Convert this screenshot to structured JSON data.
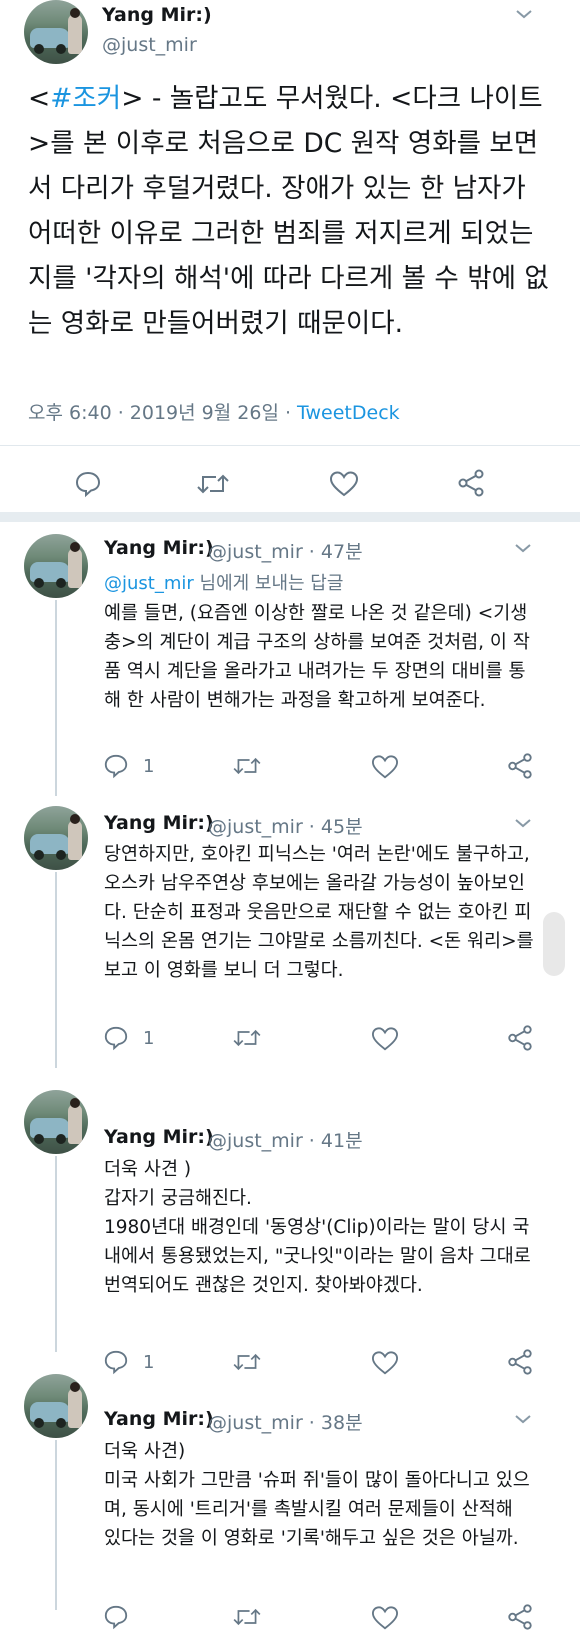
{
  "main_tweet": {
    "author_name": "Yang Mir:)",
    "author_handle": "@just_mir",
    "text_parts": {
      "before_tag": "<",
      "hashtag": "#조커",
      "after_tag": "> - 놀랍고도 무서웠다. <다크 나이트>를 본 이후로 처음으로 DC 원작 영화를 보면서 다리가 후덜거렸다. 장애가 있는 한 남자가 어떠한 이유로 그러한 범죄를 저지르게 되었는지를 '각자의 해석'에 따라 다르게 볼 수 밖에 없는 영화로 만들어버렸기 때문이다."
    },
    "timestamp": "오후 6:40 · 2019년 9월 26일 · ",
    "source": "TweetDeck"
  },
  "replies": [
    {
      "author_name": "Yang Mir:)",
      "handle_time": "@just_mir · 47분",
      "reply_to_link": "@just_mir",
      "reply_to_suffix": " 님에게 보내는 답글",
      "text": "예를 들면, (요즘엔 이상한 짤로 나온 것 같은데) <기생충>의 계단이 계급 구조의 상하를 보여준 것처럼, 이 작품 역시 계단을 올라가고 내려가는 두 장면의 대비를 통해 한 사람이 변해가는 과정을 확고하게 보여준다.",
      "reply_count": "1"
    },
    {
      "author_name": "Yang Mir:)",
      "handle_time": "@just_mir · 45분",
      "text": "당연하지만, 호아킨 피닉스는 '여러 논란'에도 불구하고, 오스카 남우주연상 후보에는 올라갈 가능성이 높아보인다. 단순히 표정과 웃음만으로 재단할 수 없는 호아킨 피닉스의 온몸 연기는 그야말로 소름끼친다. <돈 워리>를 보고 이 영화를 보니 더 그렇다.",
      "reply_count": "1"
    },
    {
      "author_name": "Yang Mir:)",
      "handle_time": "@just_mir · 41분",
      "text_lines": [
        "더욱 사견 )",
        "갑자기 궁금해진다.",
        "1980년대 배경인데 '동영상'(Clip)이라는 말이 당시 국내에서 통용됐었는지, \"굿나잇\"이라는 말이 음차 그대로 번역되어도 괜찮은 것인지. 찾아봐야겠다."
      ],
      "reply_count": "1"
    },
    {
      "author_name": "Yang Mir:)",
      "handle_time": "@just_mir · 38분",
      "text_lines": [
        "더욱 사견)",
        "미국 사회가 그만큼 '슈퍼 쥐'들이 많이 돌아다니고 있으며, 동시에 '트리거'를 촉발시킬 여러 문제들이 산적해 있다는 것을 이 영화로 '기록'해두고 싶은 것은 아닐까."
      ]
    }
  ],
  "colors": {
    "link": "#1b95e0",
    "secondary_text": "#657786",
    "divider": "#e1e8ed"
  }
}
